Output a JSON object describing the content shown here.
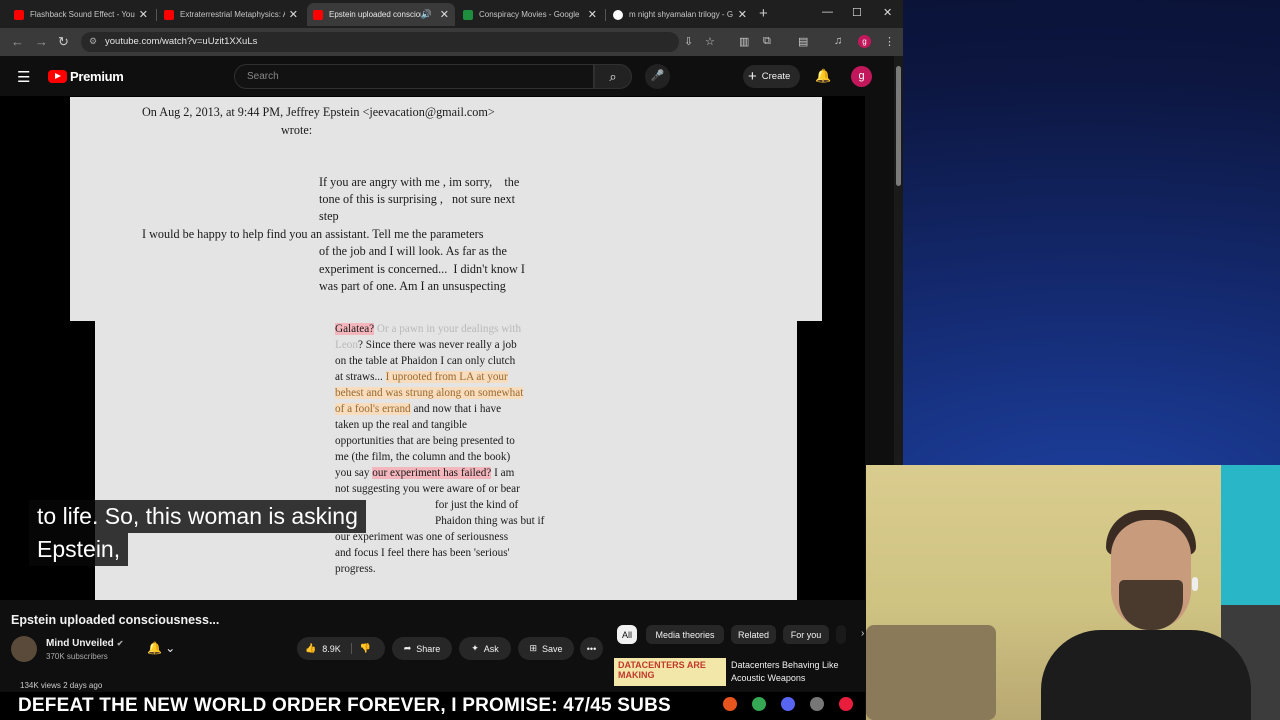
{
  "browser": {
    "tabs": [
      {
        "title": "Flashback Sound Effect - YouTube",
        "active": false
      },
      {
        "title": "Extraterrestrial Metaphysics: A",
        "active": false
      },
      {
        "title": "Epstein uploaded consciousness",
        "active": true
      },
      {
        "title": "Conspiracy Movies - Google",
        "active": false
      },
      {
        "title": "m night shyamalan trilogy - G",
        "active": false
      }
    ],
    "url": "youtube.com/watch?v=uUzit1XXuLs",
    "profile_initial": "g"
  },
  "youtube": {
    "logo_text": "Premium",
    "search_placeholder": "Search",
    "create_label": "Create",
    "avatar_initial": "g"
  },
  "document": {
    "header_line1": "On Aug 2, 2013, at 9:44 PM, Jeffrey Epstein <jeevacation@gmail.com>",
    "header_line2": "wrote:",
    "quote_l1": "If you are angry with me , im sorry,    the",
    "quote_l2": "tone of this is surprising ,   not sure next",
    "quote_l3": "step",
    "quote_l4": "I would be happy to help find you an assistant. Tell me the parameters",
    "quote_l5": "of the job and I will look. As far as the",
    "quote_l6": "experiment is concerned...  I didn't know I",
    "quote_l7": "was part of one. Am I an unsuspecting",
    "reply_galatea": "Galatea?",
    "reply_faded1": " Or a pawn in your dealings with",
    "reply_faded2": "Leon",
    "reply_l2": "? Since there was never really a job",
    "reply_l3": "on the table at Phaidon I can only clutch",
    "reply_l4a": "at straws... ",
    "reply_l4b": "I uprooted from LA at your",
    "reply_l5a": "behest",
    "reply_l5b": " and was strung along on somewhat",
    "reply_l6a": "of a fool's errand",
    "reply_l6b": " and now that i have",
    "reply_l7": "taken up the real and tangible",
    "reply_l8": "opportunities that are being presented to",
    "reply_l9": "me (the film, the column and the book)",
    "reply_l10a": "you say ",
    "reply_l10b": "our experiment has failed?",
    "reply_l10c": " I am",
    "reply_l11": "not suggesting you were aware of or bear",
    "reply_l12": "for just the kind of",
    "reply_l13": "Phaidon thing was but if",
    "reply_l14": "our experiment was one of seriousness",
    "reply_l15": "and focus I feel there has been 'serious'",
    "reply_l16": "progress."
  },
  "caption": {
    "line1": "to life. So, this woman is asking",
    "line2": "Epstein,"
  },
  "video_info": {
    "title": "Epstein uploaded consciousness...",
    "channel": "Mind Unveiled",
    "subscribers": "370K subscribers",
    "likes": "8.9K",
    "share_label": "Share",
    "ask_label": "Ask",
    "save_label": "Save",
    "views_partial": "134K views  2 days ago"
  },
  "chips": [
    "All",
    "Media theories",
    "Related",
    "For you"
  ],
  "related": {
    "thumb_text": "DATACENTERS ARE MAKING",
    "title": "Datacenters Behaving Like Acoustic Weapons"
  },
  "ticker_text": "DEFEAT THE NEW WORLD ORDER FOREVER, I PROMISE: 47/45 SUBS",
  "colors": {
    "youtube_red": "#ff0000",
    "highlight_red": "#f4b6bd",
    "highlight_orange": "#f7dcbd",
    "avatar_pink": "#c2185b"
  }
}
